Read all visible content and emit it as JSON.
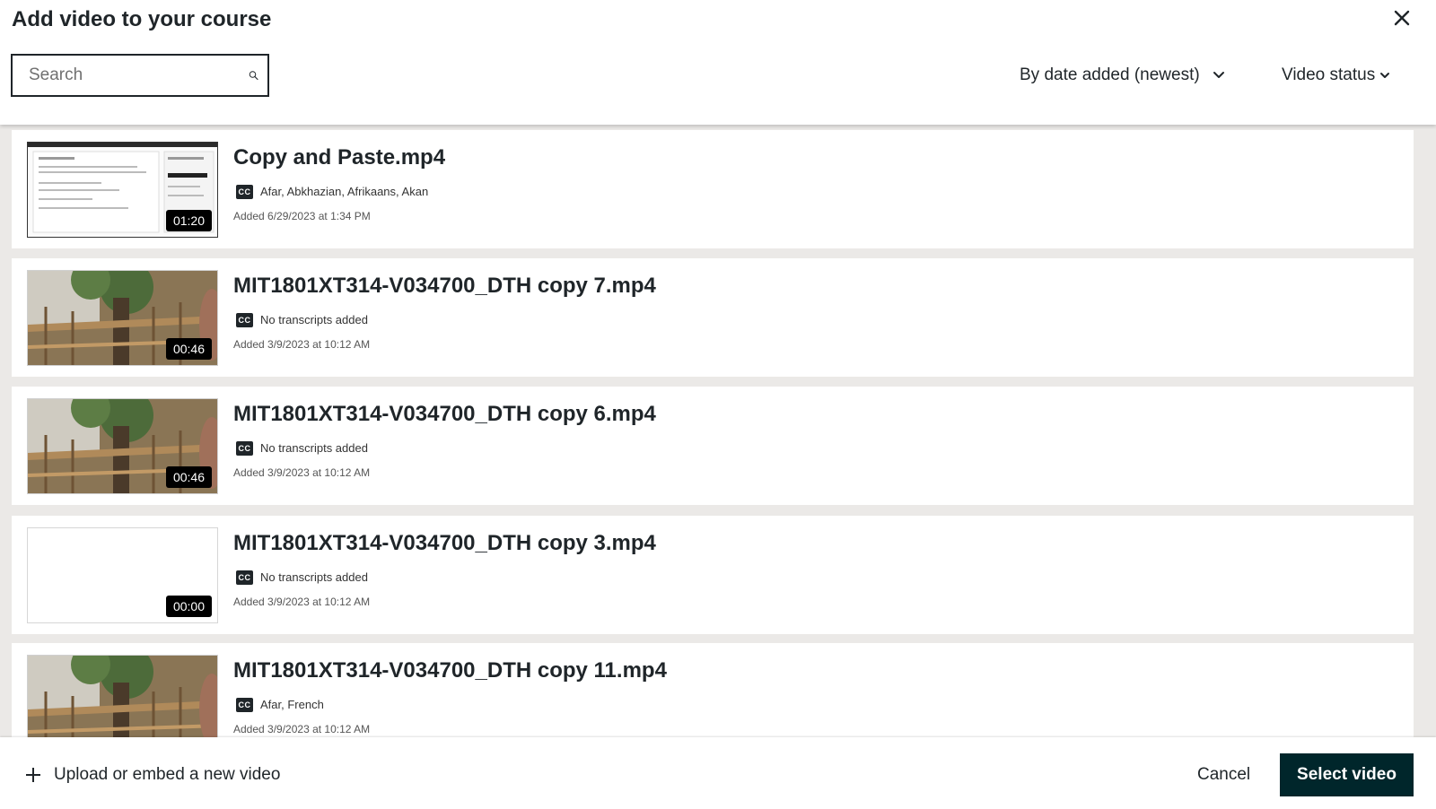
{
  "header": {
    "title": "Add video to your course",
    "search_placeholder": "Search",
    "sort_label": "By date added (newest)",
    "status_label": "Video status"
  },
  "videos": [
    {
      "name": "Copy and Paste.mp4",
      "duration": "01:20",
      "transcripts": "Afar, Abkhazian, Afrikaans, Akan",
      "added": "Added 6/29/2023 at 1:34 PM",
      "thumb": "doc"
    },
    {
      "name": "MIT1801XT314-V034700_DTH copy 7.mp4",
      "duration": "00:46",
      "transcripts": "No transcripts added",
      "added": "Added 3/9/2023 at 10:12 AM",
      "thumb": "tree"
    },
    {
      "name": "MIT1801XT314-V034700_DTH copy 6.mp4",
      "duration": "00:46",
      "transcripts": "No transcripts added",
      "added": "Added 3/9/2023 at 10:12 AM",
      "thumb": "tree"
    },
    {
      "name": "MIT1801XT314-V034700_DTH copy 3.mp4",
      "duration": "00:00",
      "transcripts": "No transcripts added",
      "added": "Added 3/9/2023 at 10:12 AM",
      "thumb": "blank"
    },
    {
      "name": "MIT1801XT314-V034700_DTH copy 11.mp4",
      "duration": "",
      "transcripts": "Afar, French",
      "added": "Added 3/9/2023 at 10:12 AM",
      "thumb": "tree"
    }
  ],
  "footer": {
    "upload_label": "Upload or embed a new video",
    "cancel_label": "Cancel",
    "select_label": "Select video"
  },
  "colors": {
    "primary": "#00262b",
    "text": "#1f2529",
    "list_background": "#ebe9e7"
  },
  "icons": {
    "close": "close-icon",
    "search": "search-icon",
    "sort": "chevron-down-icon",
    "status": "chevron-down-icon",
    "transcripts": "closed-captions-icon",
    "upload": "plus-icon"
  }
}
